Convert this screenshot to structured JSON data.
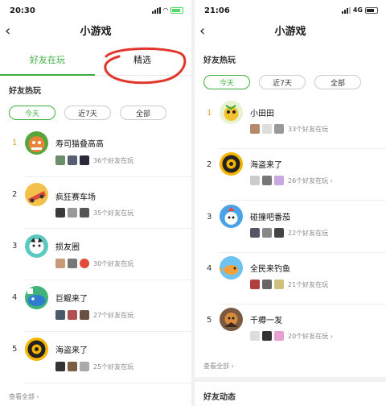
{
  "left": {
    "status": {
      "time": "20:30"
    },
    "nav": {
      "title": "小游戏"
    },
    "tabs": [
      "好友在玩",
      "精选"
    ],
    "section_title": "好友热玩",
    "filters": [
      "今天",
      "近7天",
      "全部"
    ],
    "games": [
      {
        "rank": "1",
        "name": "寿司猫叠高高",
        "count": "36个好友在玩"
      },
      {
        "rank": "2",
        "name": "疯狂赛车场",
        "count": "35个好友在玩"
      },
      {
        "rank": "3",
        "name": "损友圈",
        "count": "30个好友在玩"
      },
      {
        "rank": "4",
        "name": "巨鲲来了",
        "count": "27个好友在玩"
      },
      {
        "rank": "5",
        "name": "海盗来了",
        "count": "25个好友在玩"
      }
    ],
    "see_all": "查看全部 ›"
  },
  "right": {
    "status": {
      "time": "21:06",
      "network": "4G"
    },
    "nav": {
      "title": "小游戏"
    },
    "section_title": "好友热玩",
    "filters": [
      "今天",
      "近7天",
      "全部"
    ],
    "games": [
      {
        "rank": "1",
        "name": "小田田",
        "count": "33个好友在玩"
      },
      {
        "rank": "2",
        "name": "海盗来了",
        "count": "26个好友在玩 ›"
      },
      {
        "rank": "3",
        "name": "碰撞吧番茄",
        "count": "22个好友在玩"
      },
      {
        "rank": "4",
        "name": "全民来钓鱼",
        "count": "21个好友在玩"
      },
      {
        "rank": "5",
        "name": "千樽一发",
        "count": "20个好友在玩 ›"
      }
    ],
    "see_all": "查看全部 ›",
    "friends_activity": "好友动态"
  },
  "colors": {
    "accent": "#3dae3d",
    "rank1": "#d9a33b",
    "annotation": "#e0362c"
  }
}
